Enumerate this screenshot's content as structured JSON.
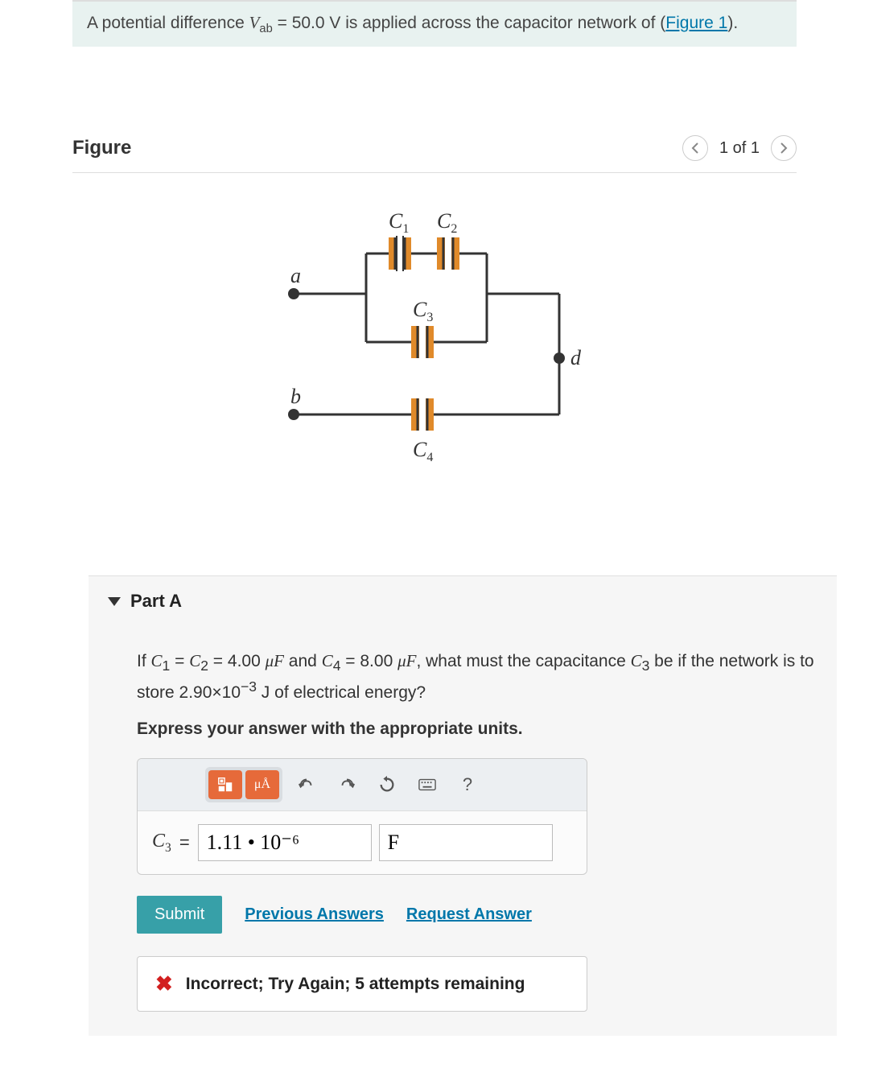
{
  "problem": {
    "prefix": "A potential difference ",
    "var": "V",
    "sub": "ab",
    "middle": " = 50.0 V is applied across the capacitor network of (",
    "link_text": "Figure 1",
    "suffix": ")."
  },
  "figure": {
    "title": "Figure",
    "counter": "1 of 1",
    "labels": {
      "a": "a",
      "b": "b",
      "d": "d",
      "c1": "C",
      "c1_sub": "1",
      "c2": "C",
      "c2_sub": "2",
      "c3": "C",
      "c3_sub": "3",
      "c4": "C",
      "c4_sub": "4"
    }
  },
  "partA": {
    "header": "Part A",
    "question": {
      "p1": "If ",
      "c1": "C",
      "c1sub": "1",
      "eq1": " = ",
      "c2": "C",
      "c2sub": "2",
      "eq2": " = 4.00 ",
      "mu1": "μF",
      "and": " and ",
      "c4": "C",
      "c4sub": "4",
      "eq3": " = 8.00 ",
      "mu2": "μF",
      "p2": ", what must the capacitance ",
      "c3": "C",
      "c3sub": "3",
      "p3": " be if the network is to store 2.90×10",
      "exp": "−3",
      "p4": " J of electrical energy?"
    },
    "instruction": "Express your answer with the appropriate units.",
    "toolbar": {
      "units_label": "μÅ",
      "help": "?"
    },
    "answer": {
      "var": "C",
      "sub": "3",
      "equals": "=",
      "value": "1.11 • 10⁻⁶",
      "unit": "F"
    },
    "actions": {
      "submit": "Submit",
      "prev": "Previous Answers",
      "request": "Request Answer"
    },
    "feedback": "Incorrect; Try Again; 5 attempts remaining"
  }
}
